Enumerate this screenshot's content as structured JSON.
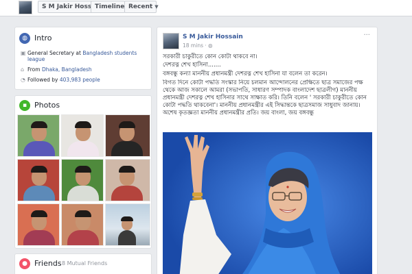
{
  "header": {
    "profile_name": "S M Jakir Hossain",
    "timeline_label": "Timeline",
    "recent_label": "Recent"
  },
  "intro": {
    "title": "Intro",
    "job_prefix": "General Secretary at ",
    "job_link": "Bangladesh students league",
    "from_prefix": "From ",
    "from_link": "Dhaka, Bangladesh",
    "followers_prefix": "Followed by ",
    "followers_link": "403,983 people"
  },
  "photos": {
    "title": "Photos"
  },
  "friends": {
    "title": "Friends",
    "mutual": "8 Mutual Friends"
  },
  "post": {
    "author": "S M Jakir Hossain",
    "time": "18 mins",
    "paragraphs": [
      "সরকারী চাকুরীতে কোন কোটা থাকবে না।",
      "দেশরত্ন শেখ হাসিনা.......",
      "বঙ্গবন্ধু কন্যা মাননীয় প্রধানমন্ত্রী দেশরত্ন শেখ হাসিনা যা বলেন তা করেন।",
      "বিগত দিনে কোটা পদ্ধতি সংস্কার নিয়ে চলমান আন্দোলনের প্রেক্ষিতে ছাত্র সমাজের পক্ষ থেকে আজ সকালে আমরা (সভাপতি, সাধারণ সম্পাদক বাংলাদেশ ছাত্রলীগ) মাননীয় প্রধানমন্ত্রী দেশরত্ন শেখ হাসিনার সাথে সাক্ষাত করি। তিনি বলেন ' সরকারী চাকুরীতে কোন কোটা পদ্ধতি থাকবেনা'। মাননীয় প্রধানমন্ত্রীর এই সিদ্ধান্তকে ছাত্রসমাজ সাধুবাদ জানায়। অশেষ কৃতজ্ঞতা মাননীয় প্রধানমন্ত্রীর প্রতি। জয় বাংলা, জয় বঙ্গবন্ধু"
    ]
  },
  "colors": {
    "link": "#365899",
    "page_bg": "#e9ebee",
    "intro_icon": "#4267b2",
    "photos_icon": "#42b72a",
    "friends_icon": "#f35369"
  },
  "icons": {
    "intro": "globe-icon",
    "job": "briefcase-icon",
    "from": "home-icon",
    "followers": "rss-icon",
    "photos": "photo-icon",
    "friends": "friends-icon"
  }
}
